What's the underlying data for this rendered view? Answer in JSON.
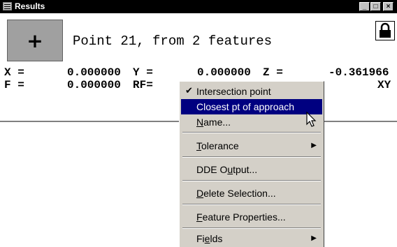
{
  "window": {
    "title": "Results",
    "controls": {
      "minimize": "_",
      "maximize": "□",
      "close": "×"
    }
  },
  "header": {
    "symbol": "+",
    "text": "Point 21, from 2 features"
  },
  "values": {
    "x_label": "X =",
    "x_value": "0.000000",
    "y_label": "Y =",
    "y_value": "0.000000",
    "z_label": "Z =",
    "z_value": "-0.361966",
    "f_label": "F =",
    "f_value": "0.000000",
    "rf_label": "RF=",
    "plane": "XY"
  },
  "context_menu": {
    "items": [
      {
        "label": "Intersection point",
        "checked": true
      },
      {
        "label": "Closest pt of approach",
        "highlighted": true
      },
      {
        "label": "Name...",
        "underline": "N",
        "rest": "ame..."
      },
      {
        "label": "Tolerance",
        "underline": "T",
        "rest": "olerance",
        "submenu": true
      },
      {
        "label": "DDE Output...",
        "pre": "DDE O",
        "underline": "u",
        "rest": "tput..."
      },
      {
        "label": "Delete Selection...",
        "underline": "D",
        "rest": "elete Selection..."
      },
      {
        "label": "Feature Properties...",
        "underline": "F",
        "rest": "eature Properties..."
      },
      {
        "label": "Fields",
        "pre": "Fi",
        "underline": "e",
        "rest": "lds",
        "submenu": true
      }
    ]
  },
  "icons": [
    "window-icon",
    "lock-icon",
    "checkmark-icon",
    "submenu-arrow-icon",
    "mouse-cursor-icon"
  ]
}
